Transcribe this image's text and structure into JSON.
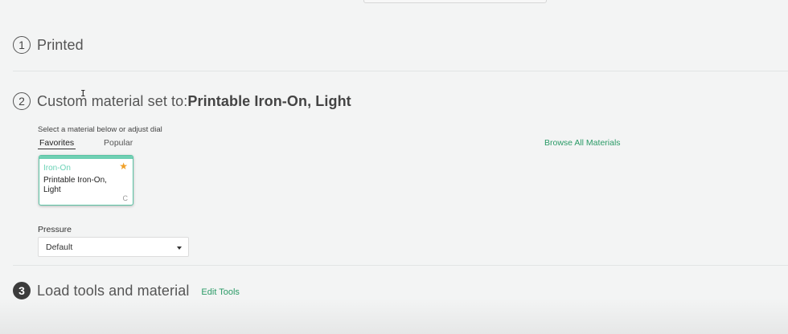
{
  "steps": [
    {
      "number": "1",
      "title": "Printed"
    },
    {
      "number": "2",
      "title_prefix": "Custom material set to:",
      "title_bold": "Printable Iron-On, Light"
    },
    {
      "number": "3",
      "title": "Load tools and material",
      "action": "Edit Tools"
    }
  ],
  "material_picker": {
    "instruction": "Select a material below or adjust dial",
    "tabs": [
      "Favorites",
      "Popular"
    ],
    "active_tab": "Favorites",
    "browse_link": "Browse All Materials",
    "card": {
      "category": "Iron-On",
      "name": "Printable Iron-On, Light",
      "favorite": true,
      "badge": "C",
      "accent_color": "#6fd0b3",
      "star_color": "#f0a028"
    }
  },
  "pressure": {
    "label": "Pressure",
    "selected": "Default"
  },
  "colors": {
    "link": "#2a9a66",
    "background": "#f3f4f4"
  }
}
